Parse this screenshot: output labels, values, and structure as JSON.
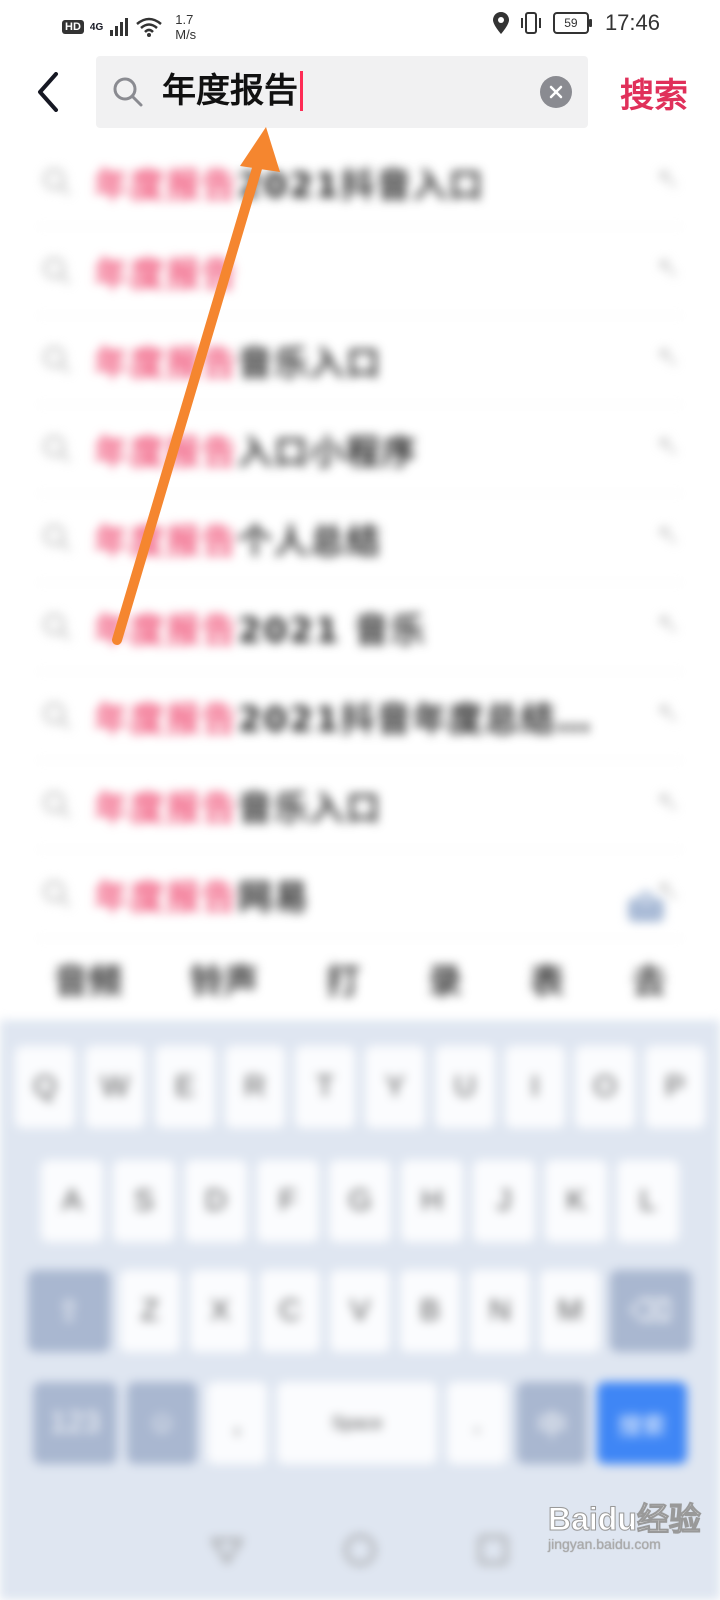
{
  "status_bar": {
    "hd": "HD",
    "network": "4G",
    "speed_value": "1.7",
    "speed_unit": "M/s",
    "battery": "59",
    "time": "17:46"
  },
  "search": {
    "query": "年度报告",
    "submit_label": "搜索"
  },
  "suggestions": [
    {
      "highlight": "年度报告",
      "rest": "2021抖音入口"
    },
    {
      "highlight": "年度报告",
      "rest": ""
    },
    {
      "highlight": "年度报告",
      "rest": "音乐入口"
    },
    {
      "highlight": "年度报告",
      "rest": "入口小程序"
    },
    {
      "highlight": "年度报告",
      "rest": "个人总结"
    },
    {
      "highlight": "年度报告",
      "rest": "2021 音乐"
    },
    {
      "highlight": "年度报告",
      "rest": "2021抖音年度总结…"
    },
    {
      "highlight": "年度报告",
      "rest": "音乐入口"
    },
    {
      "highlight": "年度报告",
      "rest": "网易"
    }
  ],
  "hot_words": [
    "音频",
    "铃声",
    "打",
    "录",
    "表",
    "去"
  ],
  "keyboard": {
    "row1": [
      "Q",
      "W",
      "E",
      "R",
      "T",
      "Y",
      "U",
      "I",
      "O",
      "P"
    ],
    "row2": [
      "A",
      "S",
      "D",
      "F",
      "G",
      "H",
      "J",
      "K",
      "L"
    ],
    "row3": [
      "Z",
      "X",
      "C",
      "V",
      "B",
      "N",
      "M"
    ],
    "space_label": "Space",
    "submit_label": "搜索"
  },
  "watermark": {
    "brand": "Baidu经验",
    "sub": "jingyan.baidu.com"
  },
  "colors": {
    "accent": "#fe2c55",
    "submit": "#e0305a",
    "arrow": "#f5862f",
    "keyboard_bg": "#dfe6f1"
  }
}
